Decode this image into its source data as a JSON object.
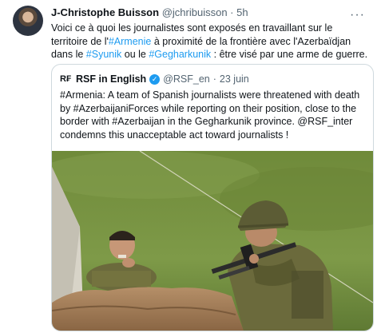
{
  "tweet": {
    "author_name": "J-Christophe Buisson",
    "author_handle": "@jchribuisson",
    "separator": "·",
    "time": "5h",
    "more_icon": "more-horizontal-icon",
    "text_parts": [
      "Voici ce à quoi les journalistes sont exposés en travaillant sur le territoire de l'",
      "#Armenie",
      " à proximité de la frontière avec l'Azerbaïdjan dans le ",
      "#Syunik",
      " ou le ",
      "#Gegharkunik",
      " : être visé par une arme de guerre."
    ]
  },
  "quote": {
    "logo": "R₣",
    "name": "RSF in English",
    "verified_icon": "verified-badge-icon",
    "handle": "@RSF_en",
    "separator": "·",
    "date": "23 juin",
    "text": "#Armenia:  A team of Spanish journalists were threatened with death by #AzerbaijaniForces while reporting on their position, close to the border with #Azerbaijan in the Gegharkunik province. @RSF_inter condemns this unacceptable act toward journalists !",
    "image_icon": "photo-icon"
  },
  "colors": {
    "link": "#1d9bf0",
    "text": "#0f1419",
    "muted": "#536471",
    "border": "#cfd9de"
  }
}
